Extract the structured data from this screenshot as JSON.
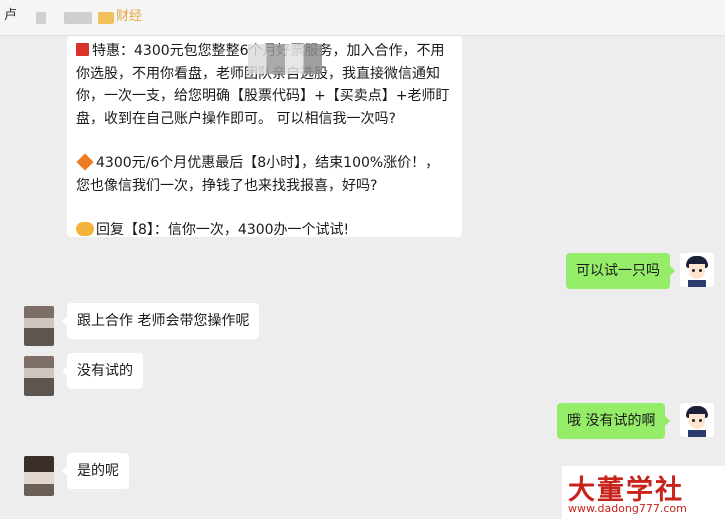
{
  "header": {
    "icon": "chat-app-icon",
    "title": "财经"
  },
  "messages": {
    "big": {
      "p1": "特惠：4300元包您整整6个月好票服务，加入合作，不用你选股，不用你看盘，老师团队亲自选股，我直接微信通知你，一次一支，给您明确【股票代码】+【买卖点】+老师盯盘，收到在自己账户操作即可。 可以相信我一次吗?",
      "p2": "4300元/6个月优惠最后【8小时】，结束100%涨价！，您也像信我们一次，挣钱了也来找我报喜，好吗?",
      "p3": "回复【8】：信你一次，4300办一个试试!"
    },
    "m1": "可以试一只吗",
    "m2": "跟上合作 老师会带您操作呢",
    "m3": "没有试的",
    "m4": "哦  没有试的啊",
    "m5": "是的呢"
  },
  "watermark": {
    "brand": "大董学社",
    "url": "www.dadong777.com"
  },
  "colors": {
    "self_bubble": "#95ec69",
    "other_bubble": "#ffffff",
    "background": "#ededed",
    "watermark_red": "#c8231b"
  }
}
